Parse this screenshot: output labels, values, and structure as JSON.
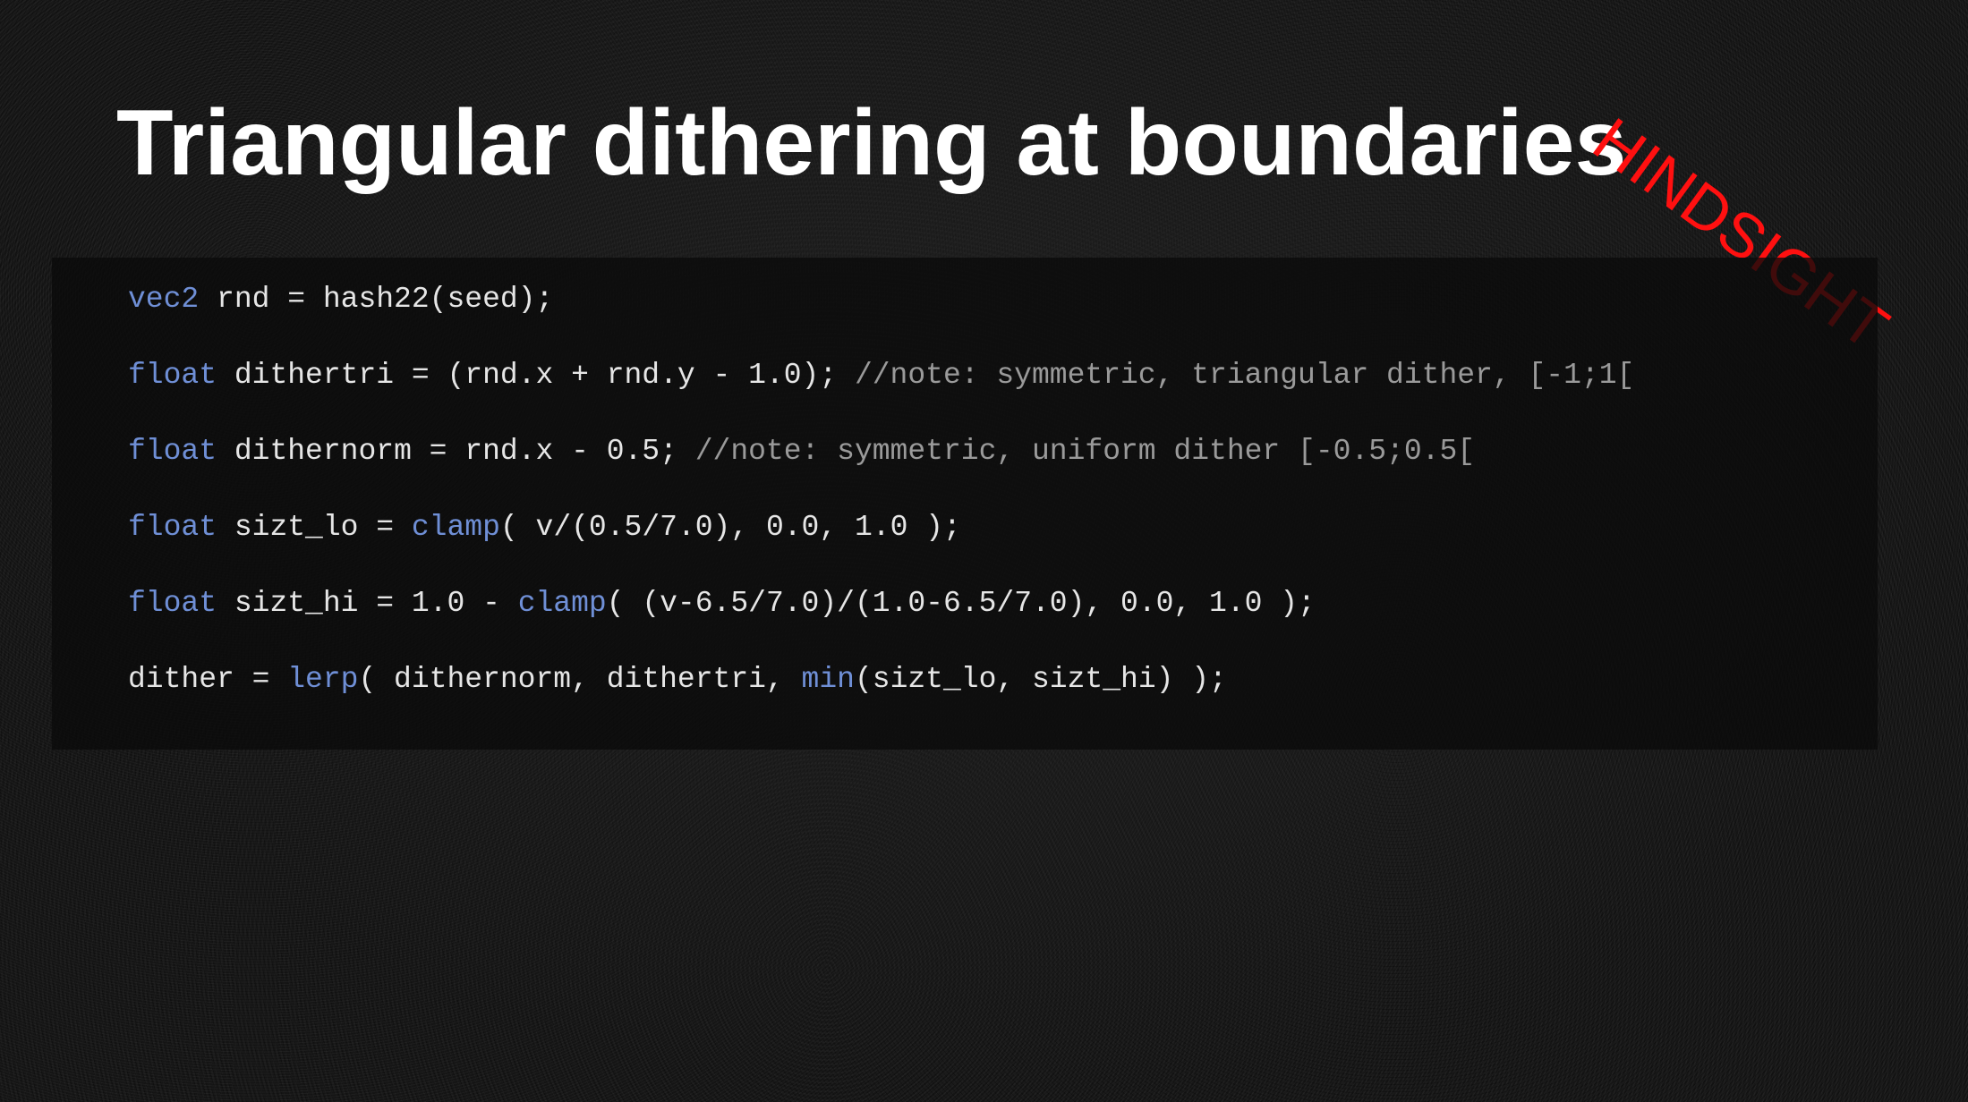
{
  "slide": {
    "title": "Triangular dithering at boundaries",
    "stamp": "HINDSIGHT"
  },
  "colors": {
    "background": "#151515",
    "title": "#ffffff",
    "stamp": "#ff1010",
    "keyword": "#6f8fd6",
    "code": "#e6e6e6",
    "comment": "#9a9a9a"
  },
  "code": {
    "line1": {
      "kw": "vec2",
      "text": " rnd = hash22(seed);"
    },
    "line2": {
      "kw": "float",
      "text": " dithertri = (rnd.x + rnd.y - 1.0); ",
      "comment": "//note: symmetric, triangular dither, [-1;1["
    },
    "line3": {
      "kw": "float",
      "text": " dithernorm = rnd.x - 0.5; ",
      "comment": "//note: symmetric, uniform dither [-0.5;0.5["
    },
    "line4": {
      "kw": "float",
      "text_a": " sizt_lo = ",
      "fn": "clamp",
      "text_b": "( v/(0.5/7.0), 0.0, 1.0 );"
    },
    "line5": {
      "kw": "float",
      "text_a": " sizt_hi = 1.0 - ",
      "fn": "clamp",
      "text_b": "( (v-6.5/7.0)/(1.0-6.5/7.0), 0.0, 1.0 );"
    },
    "line6": {
      "text_a": "dither = ",
      "fn1": "lerp",
      "text_b": "( dithernorm, dithertri, ",
      "fn2": "min",
      "text_c": "(sizt_lo, sizt_hi) );"
    }
  }
}
